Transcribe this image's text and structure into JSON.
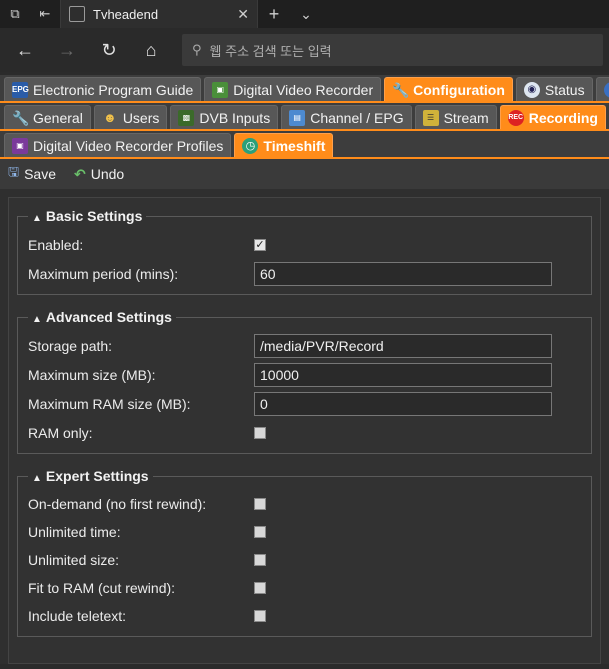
{
  "browser": {
    "tab_title": "Tvheadend",
    "address_placeholder": "웹 주소 검색 또는 입력"
  },
  "main_tabs": [
    {
      "label": "Electronic Program Guide",
      "icon": "epg-icon"
    },
    {
      "label": "Digital Video Recorder",
      "icon": "dvr-icon"
    },
    {
      "label": "Configuration",
      "icon": "wrench-icon",
      "active": true
    },
    {
      "label": "Status",
      "icon": "status-icon"
    }
  ],
  "config_tabs": [
    {
      "label": "General",
      "icon": "wrench-icon"
    },
    {
      "label": "Users",
      "icon": "users-icon"
    },
    {
      "label": "DVB Inputs",
      "icon": "dvb-icon"
    },
    {
      "label": "Channel / EPG",
      "icon": "channel-icon"
    },
    {
      "label": "Stream",
      "icon": "stream-icon"
    },
    {
      "label": "Recording",
      "icon": "rec-icon",
      "active": true
    }
  ],
  "recording_tabs": [
    {
      "label": "Digital Video Recorder Profiles",
      "icon": "dvr-profiles-icon"
    },
    {
      "label": "Timeshift",
      "icon": "clock-icon",
      "active": true
    }
  ],
  "toolbar": {
    "save_label": "Save",
    "undo_label": "Undo"
  },
  "basic": {
    "legend": "Basic Settings",
    "enabled_label": "Enabled:",
    "enabled": true,
    "max_period_label": "Maximum period (mins):",
    "max_period_value": "60"
  },
  "advanced": {
    "legend": "Advanced Settings",
    "storage_path_label": "Storage path:",
    "storage_path_value": "/media/PVR/Record",
    "max_size_label": "Maximum size (MB):",
    "max_size_value": "10000",
    "max_ram_label": "Maximum RAM size (MB):",
    "max_ram_value": "0",
    "ram_only_label": "RAM only:",
    "ram_only": false
  },
  "expert": {
    "legend": "Expert Settings",
    "ondemand_label": "On-demand (no first rewind):",
    "unlimited_time_label": "Unlimited time:",
    "unlimited_size_label": "Unlimited size:",
    "fit_ram_label": "Fit to RAM (cut rewind):",
    "teletext_label": "Include teletext:"
  },
  "colors": {
    "accent": "#ff8c1a",
    "background": "#2b2b2b"
  }
}
